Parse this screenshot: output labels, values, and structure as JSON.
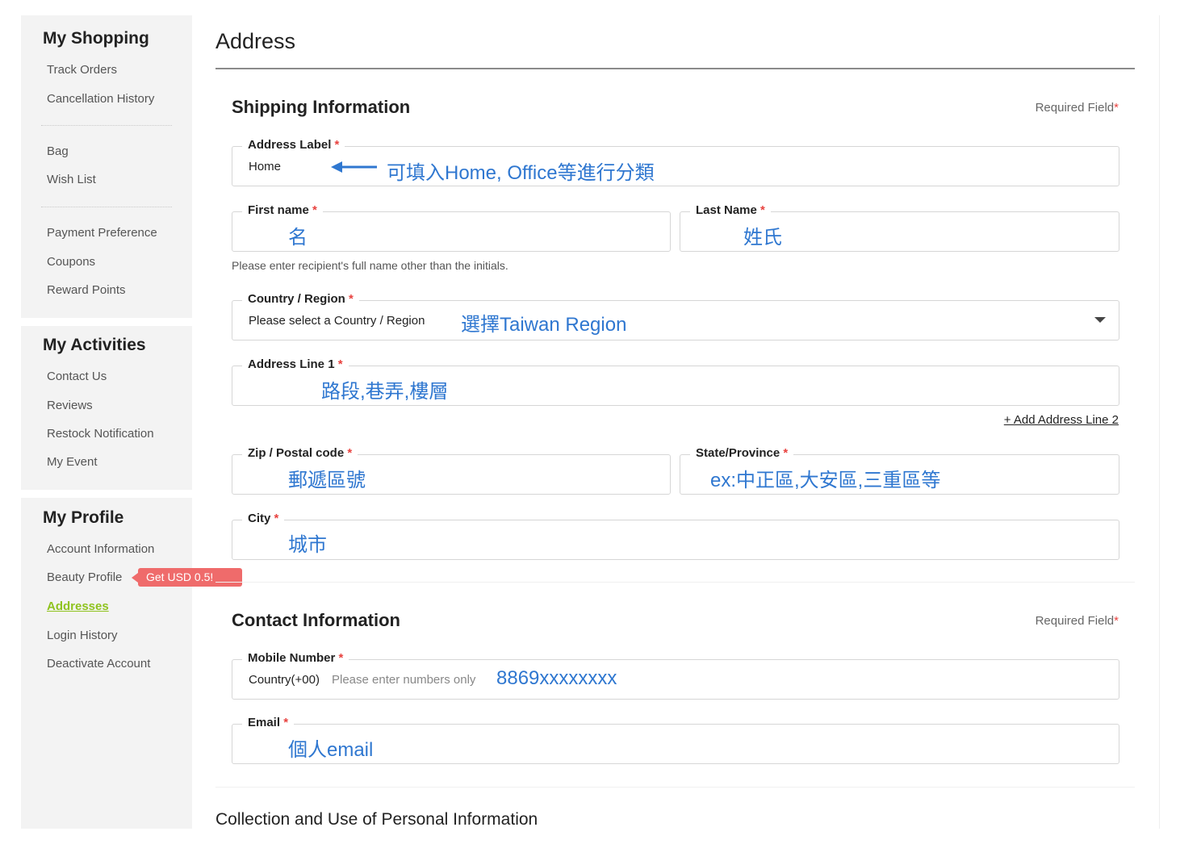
{
  "sidebar": {
    "shopping": {
      "title": "My Shopping",
      "items": [
        "Track Orders",
        "Cancellation History",
        "Bag",
        "Wish List",
        "Payment Preference",
        "Coupons",
        "Reward Points"
      ]
    },
    "activities": {
      "title": "My Activities",
      "items": [
        "Contact Us",
        "Reviews",
        "Restock Notification",
        "My Event"
      ]
    },
    "profile": {
      "title": "My Profile",
      "items": [
        "Account Information",
        "Beauty Profile",
        "Addresses",
        "Login History",
        "Deactivate Account"
      ],
      "active": "Addresses",
      "promo": "Get USD 0.5!"
    }
  },
  "page": {
    "title": "Address"
  },
  "shipping": {
    "title": "Shipping Information",
    "required_label": "Required Field",
    "required_star": "*",
    "address_label": {
      "label": "Address Label",
      "value": "Home",
      "note": "可填入Home, Office等進行分類"
    },
    "first_name": {
      "label": "First name",
      "note": "名"
    },
    "last_name": {
      "label": "Last Name",
      "note": "姓氏"
    },
    "name_hint": "Please enter recipient's full name other than the initials.",
    "country": {
      "label": "Country / Region",
      "value": "Please select a Country / Region",
      "note": "選擇Taiwan Region"
    },
    "address_line1": {
      "label": "Address Line 1",
      "note": "路段,巷弄,樓層"
    },
    "add_line2": "+ Add Address Line 2",
    "zip": {
      "label": "Zip / Postal code",
      "note": "郵遞區號"
    },
    "state": {
      "label": "State/Province",
      "note": "ex:中正區,大安區,三重區等"
    },
    "city": {
      "label": "City",
      "note": "城市"
    }
  },
  "contact": {
    "title": "Contact Information",
    "required_label": "Required Field",
    "required_star": "*",
    "mobile": {
      "label": "Mobile Number",
      "country_code": "Country(+00)",
      "placeholder": "Please enter numbers only",
      "note": "8869xxxxxxxx"
    },
    "email": {
      "label": "Email",
      "note": "個人email"
    }
  },
  "collection": {
    "title": "Collection and Use of Personal Information"
  },
  "colors": {
    "accent_green": "#8fc31f",
    "annotation_blue": "#2f77d0",
    "required_red": "#e8423f",
    "promo_red": "#ef6b6b"
  }
}
